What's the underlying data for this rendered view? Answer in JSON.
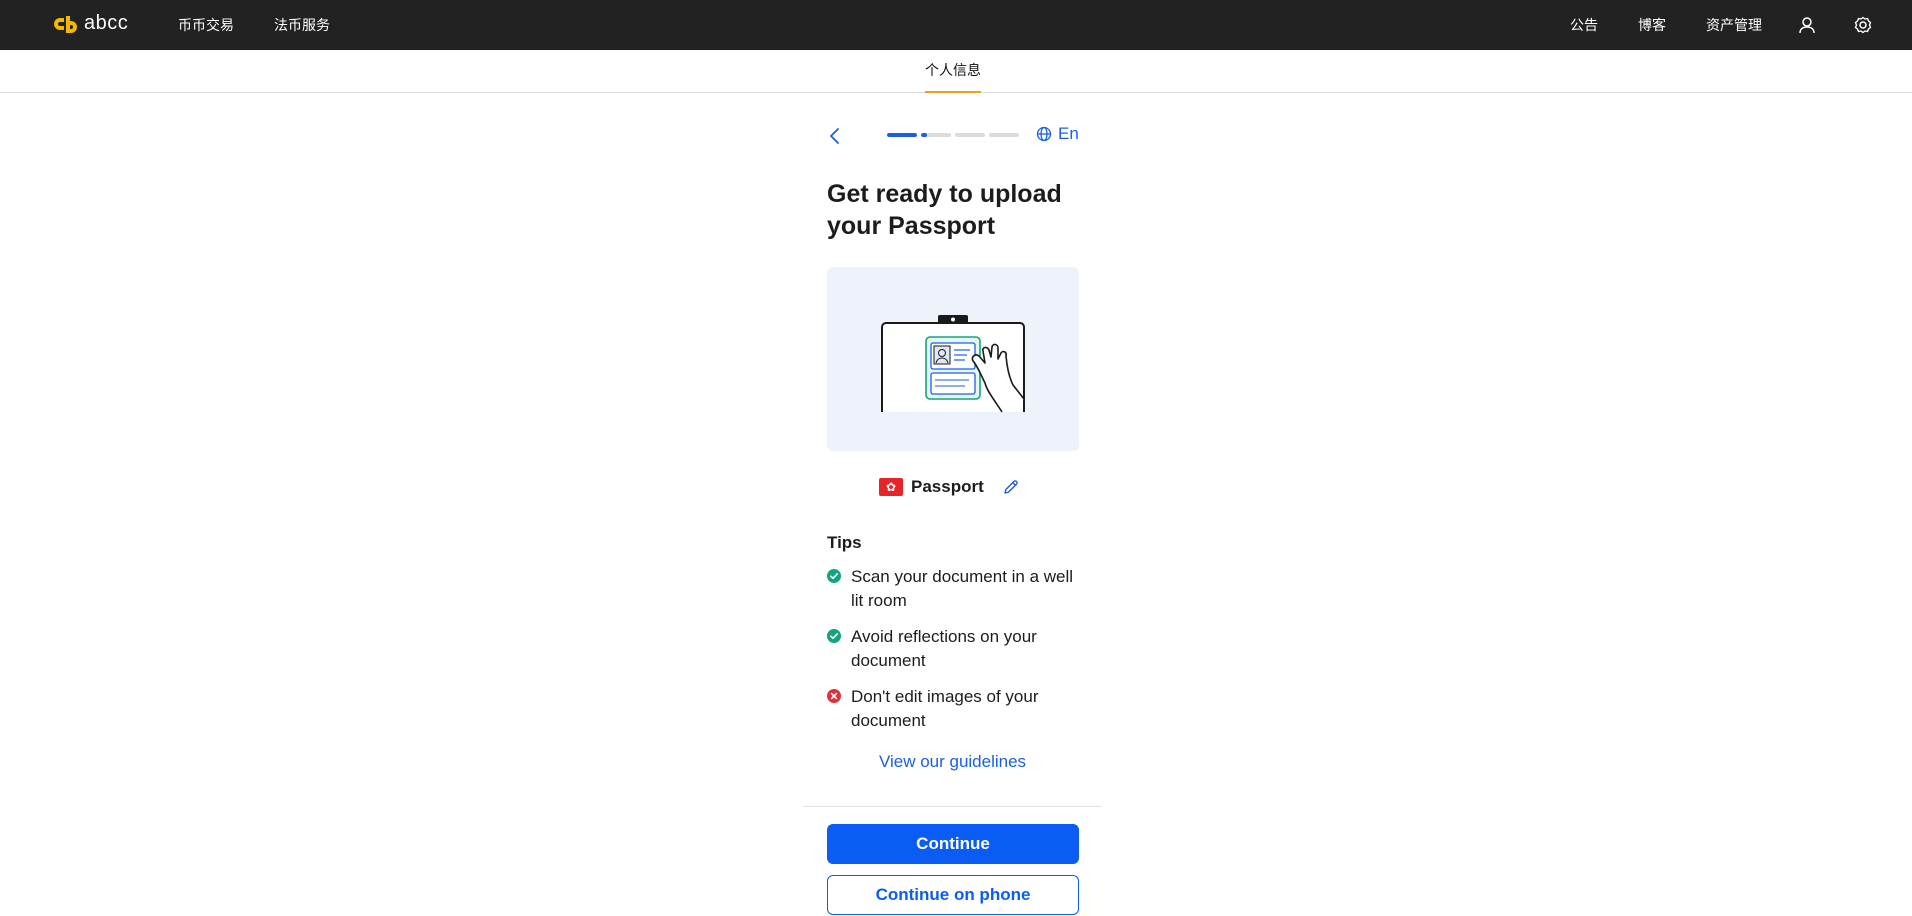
{
  "header": {
    "logo_text": "abcc",
    "nav_left": [
      "币币交易",
      "法币服务"
    ],
    "nav_right": [
      "公告",
      "博客",
      "资产管理"
    ],
    "icons": [
      "user-icon",
      "settings-icon"
    ],
    "colors": {
      "bar": "#222222",
      "logo_accent": "#f5b800"
    }
  },
  "subnav": {
    "active_tab": "个人信息",
    "accent": "#f0a020"
  },
  "verification": {
    "progress": {
      "steps": 4,
      "current_step_fill": [
        1.0,
        0.2,
        0,
        0
      ]
    },
    "language_label": "En",
    "title": "Get ready to upload your Passport",
    "document": {
      "flag_icon": "hong-kong-flag-icon",
      "name": "Passport"
    },
    "tips_title": "Tips",
    "tips": [
      {
        "status": "do",
        "icon": "check-circle-icon",
        "text": "Scan your document in a well lit room"
      },
      {
        "status": "do",
        "icon": "check-circle-icon",
        "text": "Avoid reflections on your document"
      },
      {
        "status": "dont",
        "icon": "cross-circle-icon",
        "text": "Don't edit images of your document"
      }
    ],
    "guidelines_link": "View our guidelines",
    "continue_label": "Continue",
    "continue_phone_label": "Continue on phone",
    "colors": {
      "primary": "#0a5cf5",
      "success": "#14a37f",
      "error": "#e0323c"
    }
  }
}
